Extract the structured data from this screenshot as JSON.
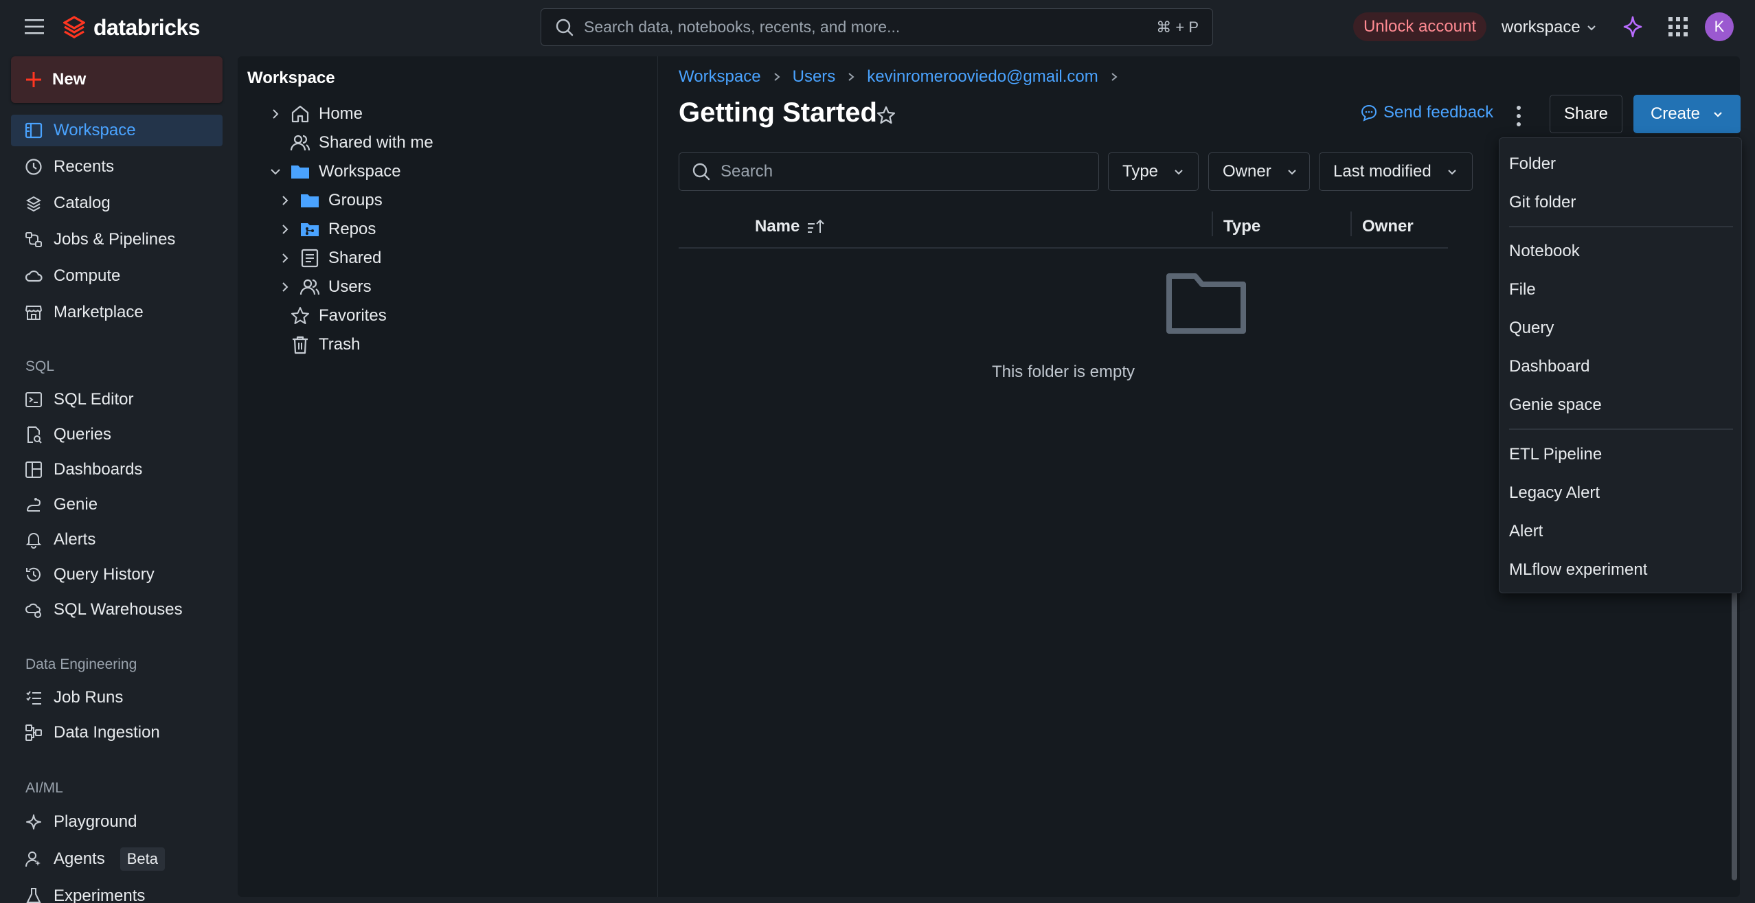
{
  "topbar": {
    "brand": "databricks",
    "search_placeholder": "Search data, notebooks, recents, and more...",
    "search_shortcut": "⌘ + P",
    "unlock_label": "Unlock account",
    "workspace_label": "workspace",
    "avatar_initial": "K"
  },
  "nav": {
    "new_label": "New",
    "items": [
      {
        "label": "Workspace"
      },
      {
        "label": "Recents"
      },
      {
        "label": "Catalog"
      },
      {
        "label": "Jobs & Pipelines"
      },
      {
        "label": "Compute"
      },
      {
        "label": "Marketplace"
      }
    ],
    "sql_section": "SQL",
    "sql_items": [
      {
        "label": "SQL Editor"
      },
      {
        "label": "Queries"
      },
      {
        "label": "Dashboards"
      },
      {
        "label": "Genie"
      },
      {
        "label": "Alerts"
      },
      {
        "label": "Query History"
      },
      {
        "label": "SQL Warehouses"
      }
    ],
    "de_section": "Data Engineering",
    "de_items": [
      {
        "label": "Job Runs"
      },
      {
        "label": "Data Ingestion"
      }
    ],
    "ai_section": "AI/ML",
    "ai_items": [
      {
        "label": "Playground"
      },
      {
        "label": "Agents",
        "badge": "Beta"
      },
      {
        "label": "Experiments"
      }
    ]
  },
  "tree": {
    "title": "Workspace",
    "rows": [
      {
        "label": "Home"
      },
      {
        "label": "Shared with me"
      },
      {
        "label": "Workspace"
      },
      {
        "label": "Groups"
      },
      {
        "label": "Repos"
      },
      {
        "label": "Shared"
      },
      {
        "label": "Users"
      },
      {
        "label": "Favorites"
      },
      {
        "label": "Trash"
      }
    ]
  },
  "main": {
    "breadcrumbs": [
      "Workspace",
      "Users",
      "kevinromerooviedo@gmail.com"
    ],
    "title": "Getting Started",
    "feedback_label": "Send feedback",
    "share_label": "Share",
    "create_label": "Create",
    "search_placeholder": "Search",
    "filters": [
      "Type",
      "Owner",
      "Last modified"
    ],
    "columns": [
      "Name",
      "Type",
      "Owner"
    ],
    "empty_text": "This folder is empty"
  },
  "create_menu": {
    "items": [
      "Folder",
      "Git folder",
      "Notebook",
      "File",
      "Query",
      "Dashboard",
      "Genie space",
      "ETL Pipeline",
      "Legacy Alert",
      "Alert",
      "MLflow experiment"
    ]
  },
  "colors": {
    "accent": "#4aa3ff",
    "create_button": "#2272b4",
    "unlock": "#ff8a92",
    "logo": "#ff3621"
  }
}
